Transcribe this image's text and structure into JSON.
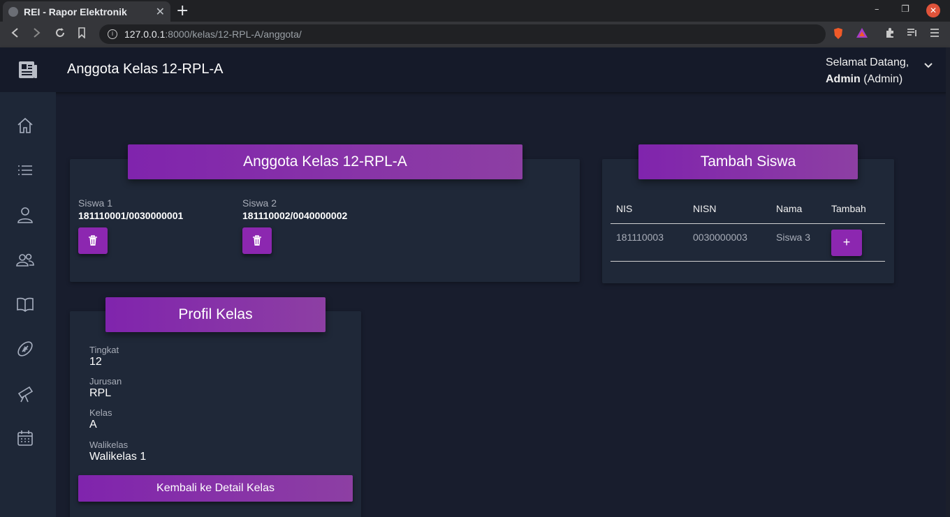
{
  "browser": {
    "tab_title": "REI - Rapor Elektronik",
    "url_host": "127.0.0.1",
    "url_path": ":8000/kelas/12-RPL-A/anggota/"
  },
  "header": {
    "title": "Anggota Kelas 12-RPL-A",
    "welcome": "Selamat Datang,",
    "user_name": "Admin",
    "user_role": "(Admin)"
  },
  "sidebar": {
    "items": [
      {
        "icon": "home-icon"
      },
      {
        "icon": "list-icon"
      },
      {
        "icon": "user-icon"
      },
      {
        "icon": "users-icon"
      },
      {
        "icon": "book-icon"
      },
      {
        "icon": "football-icon"
      },
      {
        "icon": "telescope-icon"
      },
      {
        "icon": "calendar-icon"
      }
    ]
  },
  "members_card": {
    "title": "Anggota Kelas 12-RPL-A",
    "members": [
      {
        "name": "Siswa 1",
        "id": "181110001/0030000001"
      },
      {
        "name": "Siswa 2",
        "id": "181110002/0040000002"
      }
    ]
  },
  "add_card": {
    "title": "Tambah Siswa",
    "columns": [
      "NIS",
      "NISN",
      "Nama",
      "Tambah"
    ],
    "rows": [
      {
        "nis": "181110003",
        "nisn": "0030000003",
        "nama": "Siswa 3",
        "button": "+"
      }
    ]
  },
  "profile_card": {
    "title": "Profil Kelas",
    "fields": [
      {
        "label": "Tingkat",
        "value": "12"
      },
      {
        "label": "Jurusan",
        "value": "RPL"
      },
      {
        "label": "Kelas",
        "value": "A"
      },
      {
        "label": "Walikelas",
        "value": "Walikelas 1"
      }
    ],
    "back_button": "Kembali ke Detail Kelas"
  },
  "colors": {
    "accent": "#8c27b0",
    "background": "#181d2d",
    "card": "#1f2838",
    "sidebar": "#1e2737"
  }
}
